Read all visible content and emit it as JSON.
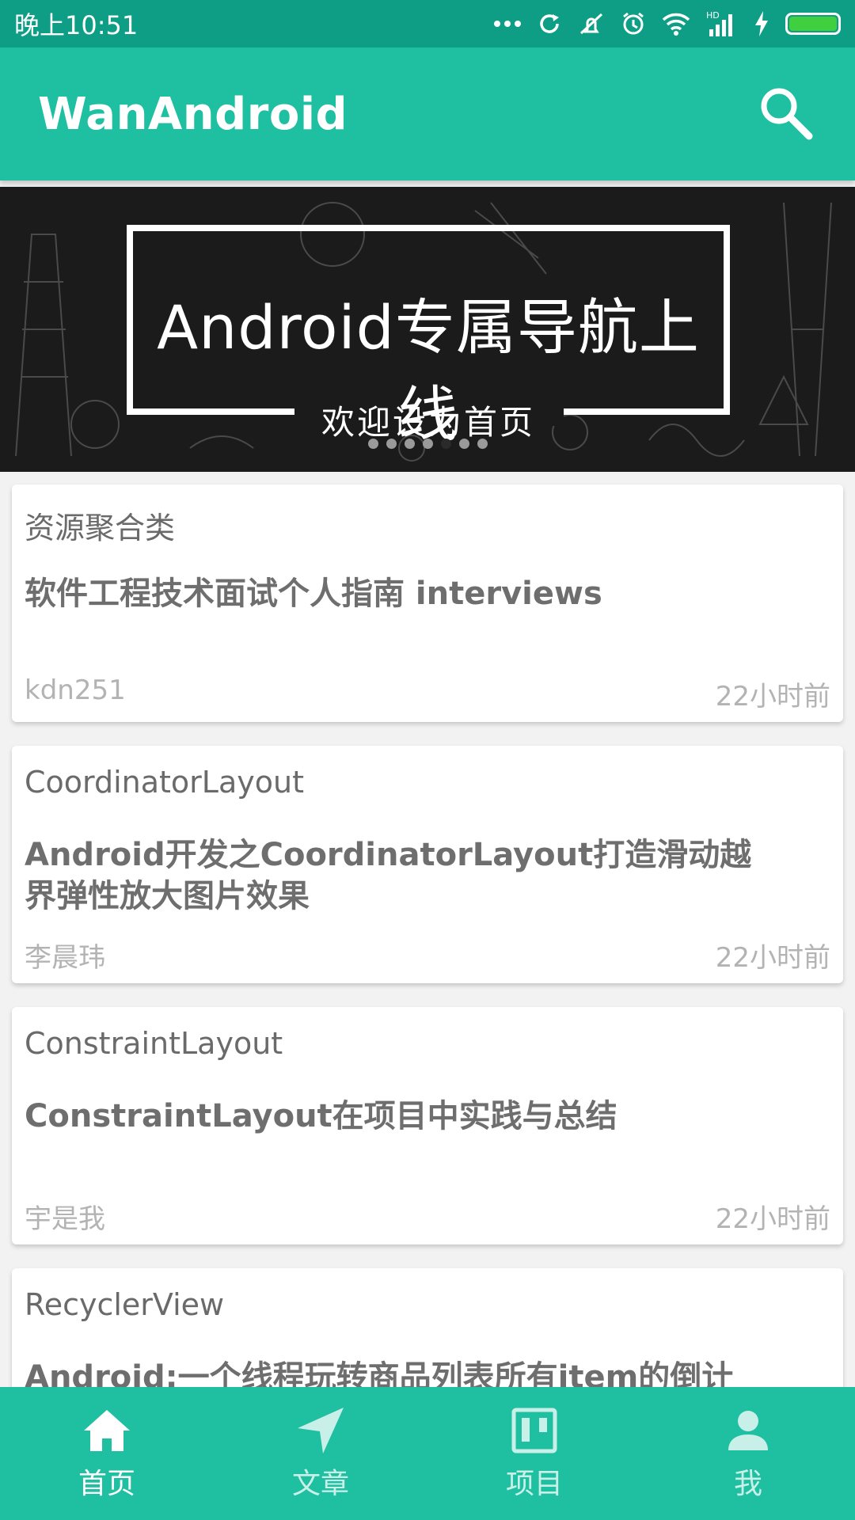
{
  "status_bar": {
    "time": "晚上10:51",
    "icons": [
      "more-dots-icon",
      "sync-icon",
      "vibrate-off-icon",
      "alarm-icon",
      "wifi-icon",
      "hd-signal-icon",
      "charging-icon",
      "battery-icon"
    ],
    "hd_label": "HD"
  },
  "app_bar": {
    "title": "WanAndroid",
    "search_icon": "search-icon"
  },
  "banner": {
    "title": "Android专属导航上线",
    "subtitle": "欢迎设为首页",
    "page_count": 7,
    "active_page_index": 4
  },
  "articles": [
    {
      "category": "资源聚合类",
      "title": "软件工程技术面试个人指南  interviews",
      "author": "kdn251",
      "time": "22小时前"
    },
    {
      "category": "CoordinatorLayout",
      "title": "Android开发之CoordinatorLayout打造滑动越界弹性放大图片效果",
      "author": "李晨玮",
      "time": "22小时前"
    },
    {
      "category": "ConstraintLayout",
      "title": "ConstraintLayout在项目中实践与总结",
      "author": "宇是我",
      "time": "22小时前"
    },
    {
      "category": "RecyclerView",
      "title": "Android:一个线程玩转商品列表所有item的倒计时",
      "author": "",
      "time": ""
    }
  ],
  "bottom_nav": {
    "items": [
      {
        "label": "首页",
        "icon": "home-icon",
        "active": true
      },
      {
        "label": "文章",
        "icon": "navigation-arrow-icon",
        "active": false
      },
      {
        "label": "项目",
        "icon": "project-board-icon",
        "active": false
      },
      {
        "label": "我",
        "icon": "person-icon",
        "active": false
      }
    ]
  },
  "colors": {
    "status_bar": "#0e9e86",
    "primary": "#1fbfa2",
    "battery": "#3fcf3f"
  }
}
